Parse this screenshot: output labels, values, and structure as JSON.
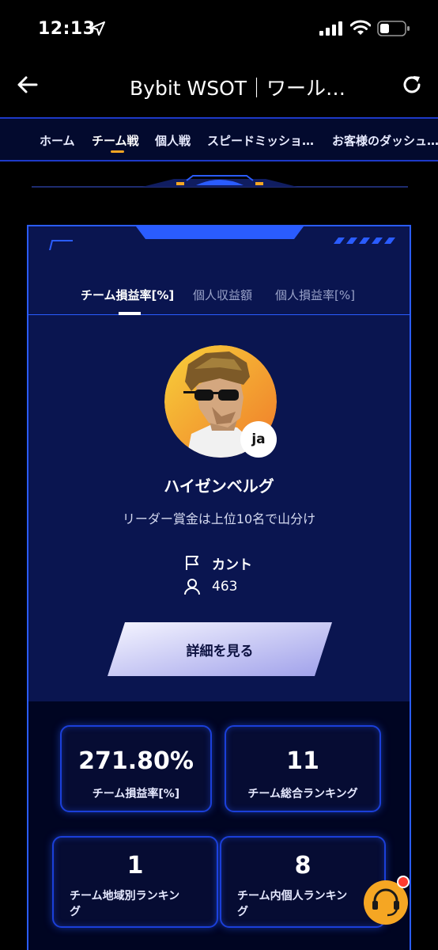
{
  "status_bar": {
    "time": "12:13"
  },
  "nav": {
    "title": "Bybit WSOT｜ワール…"
  },
  "tabs": [
    {
      "label": "ホーム"
    },
    {
      "label": "チーム戦"
    },
    {
      "label": "個人戦"
    },
    {
      "label": "スピードミッショ…"
    },
    {
      "label": "お客様のダッシュ…"
    }
  ],
  "subtabs": [
    {
      "label": "チーム損益率[%]"
    },
    {
      "label": "個人収益額"
    },
    {
      "label": "個人損益率[%]"
    }
  ],
  "profile": {
    "badge": "ja",
    "name": "ハイゼンベルグ",
    "description": "リーダー賞金は上位10名で山分け",
    "flag_label": "カント",
    "members": "463"
  },
  "detail_button": {
    "label": "詳細を見る"
  },
  "stats": [
    {
      "value": "271.80%",
      "label": "チーム損益率[%]"
    },
    {
      "value": "11",
      "label": "チーム総合ランキング"
    },
    {
      "value": "1",
      "label": "チーム地域別ランキン\nグ"
    },
    {
      "value": "8",
      "label": "チーム内個人ランキン\nグ"
    }
  ],
  "colors": {
    "accent": "#f5a623",
    "border": "#2a5cff",
    "panel": "#0a1550"
  }
}
